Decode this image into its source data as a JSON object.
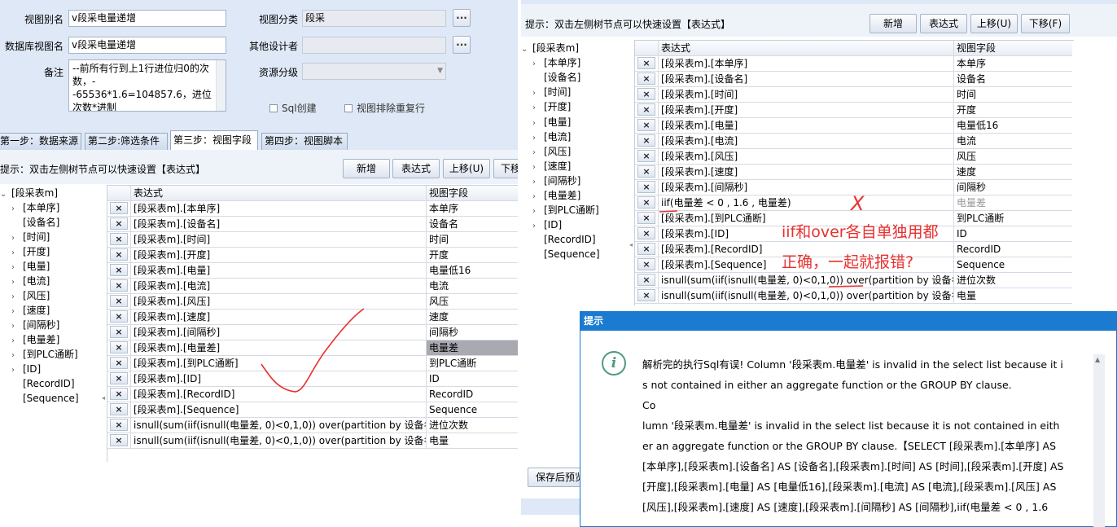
{
  "form": {
    "view_alias_label": "视图别名",
    "view_alias_value": "v段采电量递增",
    "db_view_label": "数据库视图名",
    "db_view_value": "v段采电量递增",
    "remark_label": "备注",
    "remark_value": "--前所有行到上1行进位归0的次数，--65536*1.6=104857.6，进位次数*进制",
    "view_category_label": "视图分类",
    "view_category_value": "段采",
    "other_designer_label": "其他设计者",
    "resource_level_label": "资源分级",
    "sql_create_label": "Sql创建",
    "dedupe_label": "视图排除重复行",
    "dots_label": "..."
  },
  "tabs": [
    {
      "label": "第一步：数据来源"
    },
    {
      "label": "第二步:筛选条件"
    },
    {
      "label": "第三步：视图字段"
    },
    {
      "label": "第四步：视图脚本"
    }
  ],
  "toolbar": {
    "tip": "提示：双击左侧树节点可以快速设置【表达式】",
    "new": "新增",
    "expr": "表达式",
    "up": "上移(U)",
    "down": "下移(F)",
    "down_short": "下移"
  },
  "tree": {
    "root": "[段采表m]",
    "children": [
      "[本单序]",
      "[设备名]",
      "[时间]",
      "[开度]",
      "[电量]",
      "[电流]",
      "[风压]",
      "[速度]",
      "[间隔秒]",
      "[电量差]",
      "[到PLC通断]",
      "[ID]",
      "[RecordID]",
      "[Sequence]"
    ]
  },
  "grid": {
    "header_expr": "表达式",
    "header_field": "视图字段",
    "delete_icon": "×",
    "left_rows": [
      {
        "expr": "[段采表m].[本单序]",
        "field": "本单序"
      },
      {
        "expr": "[段采表m].[设备名]",
        "field": "设备名"
      },
      {
        "expr": "[段采表m].[时间]",
        "field": "时间"
      },
      {
        "expr": "[段采表m].[开度]",
        "field": "开度"
      },
      {
        "expr": "[段采表m].[电量]",
        "field": "电量低16"
      },
      {
        "expr": "[段采表m].[电流]",
        "field": "电流"
      },
      {
        "expr": "[段采表m].[风压]",
        "field": "风压"
      },
      {
        "expr": "[段采表m].[速度]",
        "field": "速度"
      },
      {
        "expr": "[段采表m].[间隔秒]",
        "field": "间隔秒"
      },
      {
        "expr": "[段采表m].[电量差]",
        "field": "电量差"
      },
      {
        "expr": "[段采表m].[到PLC通断]",
        "field": "到PLC通断"
      },
      {
        "expr": "[段采表m].[ID]",
        "field": "ID"
      },
      {
        "expr": "[段采表m].[RecordID]",
        "field": "RecordID"
      },
      {
        "expr": "[段采表m].[Sequence]",
        "field": "Sequence"
      },
      {
        "expr": "isnull(sum(iif(isnull(电量差, 0)<0,1,0)) over(partition by 设备名 ...",
        "field": "进位次数"
      },
      {
        "expr": "isnull(sum(iif(isnull(电量差, 0)<0,1,0)) over(partition by 设备名 ...",
        "field": "电量"
      }
    ],
    "right_rows": [
      {
        "expr": "[段采表m].[本单序]",
        "field": "本单序"
      },
      {
        "expr": "[段采表m].[设备名]",
        "field": "设备名"
      },
      {
        "expr": "[段采表m].[时间]",
        "field": "时间"
      },
      {
        "expr": "[段采表m].[开度]",
        "field": "开度"
      },
      {
        "expr": "[段采表m].[电量]",
        "field": "电量低16"
      },
      {
        "expr": "[段采表m].[电流]",
        "field": "电流"
      },
      {
        "expr": "[段采表m].[风压]",
        "field": "风压"
      },
      {
        "expr": "[段采表m].[速度]",
        "field": "速度"
      },
      {
        "expr": "[段采表m].[间隔秒]",
        "field": "间隔秒"
      },
      {
        "expr": "iif(电量差 < 0 , 1.6 , 电量差)",
        "field": "电量差"
      },
      {
        "expr": "[段采表m].[到PLC通断]",
        "field": "到PLC通断"
      },
      {
        "expr": "[段采表m].[ID]",
        "field": "ID"
      },
      {
        "expr": "[段采表m].[RecordID]",
        "field": "RecordID"
      },
      {
        "expr": "[段采表m].[Sequence]",
        "field": "Sequence"
      },
      {
        "expr": "isnull(sum(iif(isnull(电量差, 0)<0,1,0)) over(partition by 设备名 ...",
        "field": "进位次数"
      },
      {
        "expr": "isnull(sum(iif(isnull(电量差, 0)<0,1,0)) over(partition by 设备名 ...",
        "field": "电量"
      }
    ]
  },
  "annotation": {
    "line1": "iif和over各自单独用都",
    "line2": "正确，一起就报错?",
    "cross": "X"
  },
  "save_preview": "保存后预览",
  "dialog": {
    "title": "提示",
    "icon": "i",
    "message": "解析完的执行Sql有误! Column '段采表m.电量差' is invalid in the select list because it is not contained in either an aggregate function or the GROUP BY clause.\nCo\nlumn '段采表m.电量差' is invalid in the select list because it is not contained in either an aggregate function or the GROUP BY clause.【SELECT [段采表m].[本单序] AS [本单序],[段采表m].[设备名] AS [设备名],[段采表m].[时间] AS [时间],[段采表m].[开度] AS [开度],[段采表m].[电量] AS [电量低16],[段采表m].[电流] AS [电流],[段采表m].[风压] AS [风压],[段采表m].[速度] AS [速度],[段采表m].[间隔秒] AS [间隔秒],iif(电量差 < 0 , 1.6"
  },
  "colors": {
    "accent": "#1a7bd0",
    "annotation": "#e8312f",
    "panel": "#dfe8f6"
  }
}
